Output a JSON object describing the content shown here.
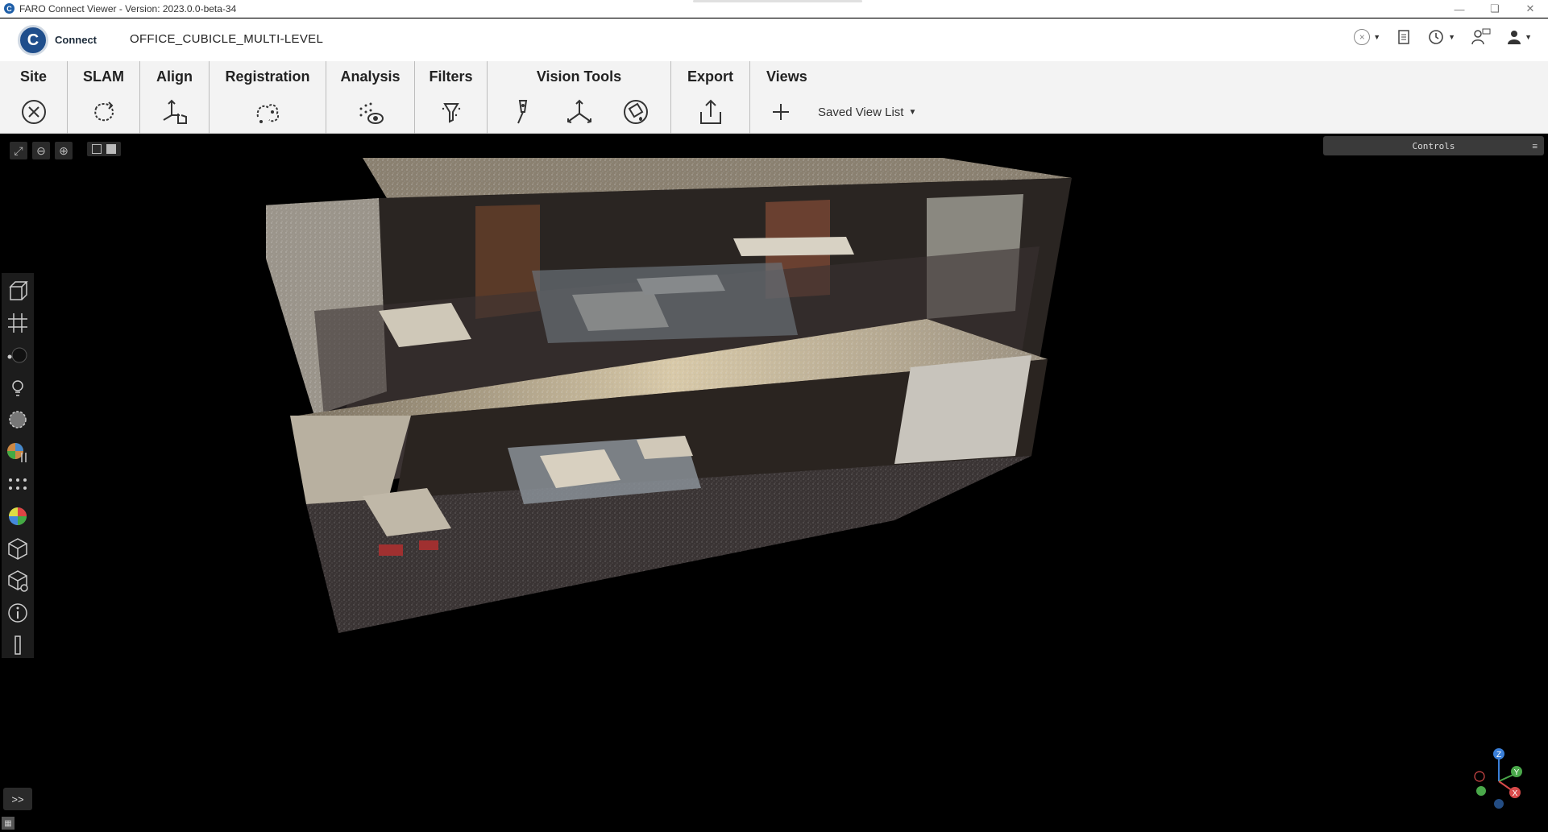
{
  "window": {
    "title": "FARO Connect Viewer - Version: 2023.0.0-beta-34",
    "controls": [
      "minimize",
      "restore",
      "close"
    ]
  },
  "header": {
    "brand": "Connect",
    "logo_letter": "C",
    "project_name": "OFFICE_CUBICLE_MULTI-LEVEL"
  },
  "ribbon": {
    "groups": [
      {
        "label": "Site",
        "icons": [
          "close-circle-icon"
        ]
      },
      {
        "label": "SLAM",
        "icons": [
          "slam-loop-icon"
        ]
      },
      {
        "label": "Align",
        "icons": [
          "align-hand-icon"
        ]
      },
      {
        "label": "Registration",
        "icons": [
          "registration-icon"
        ]
      },
      {
        "label": "Analysis",
        "icons": [
          "analysis-icon"
        ]
      },
      {
        "label": "Filters",
        "icons": [
          "filter-icon"
        ]
      },
      {
        "label": "Vision Tools",
        "icons": [
          "pin-tool-icon",
          "axes-tool-icon",
          "paint-bucket-icon"
        ]
      },
      {
        "label": "Export",
        "icons": [
          "export-icon"
        ]
      },
      {
        "label": "Views",
        "icons": [
          "add-view-icon"
        ]
      }
    ],
    "saved_view_list": "Saved View List"
  },
  "viewport": {
    "controls_label": "Controls",
    "expand_label": ">>",
    "axis_labels": {
      "z": "Z",
      "y": "Y",
      "x": "X"
    }
  },
  "colors": {
    "ribbon_bg": "#f3f3f3",
    "viewport_bg": "#000000",
    "brand_blue": "#1f4e8c"
  }
}
